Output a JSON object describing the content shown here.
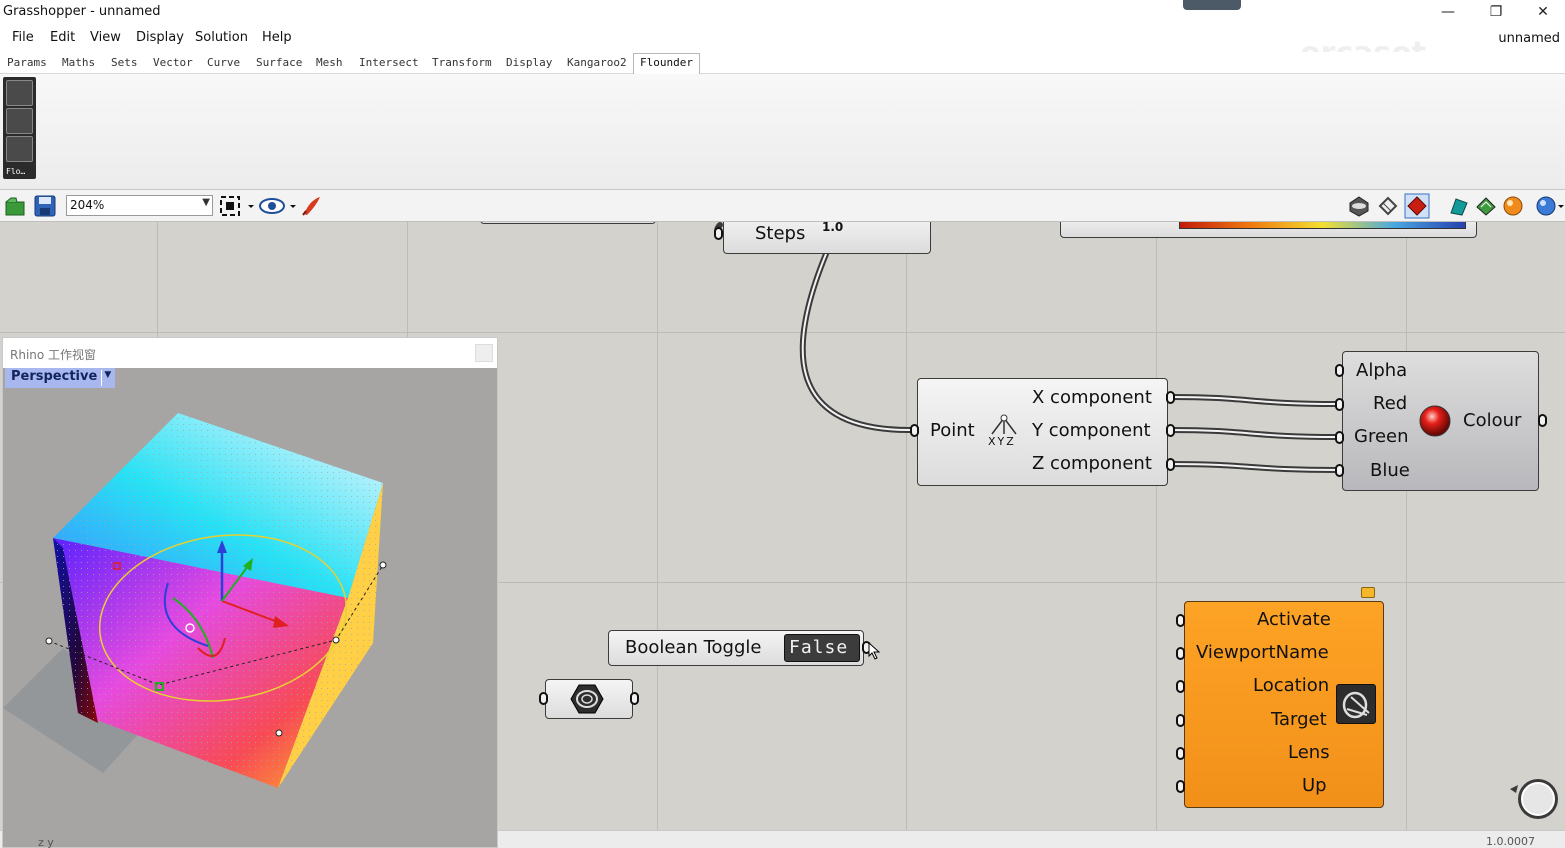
{
  "window": {
    "title": "Grasshopper - unnamed",
    "document_name": "unnamed"
  },
  "menu": [
    "File",
    "Edit",
    "View",
    "Display",
    "Solution",
    "Help"
  ],
  "tabs": [
    "Params",
    "Maths",
    "Sets",
    "Vector",
    "Curve",
    "Surface",
    "Mesh",
    "Intersect",
    "Transform",
    "Display",
    "Kangaroo2",
    "Flounder"
  ],
  "active_tab": "Flounder",
  "watermark": "orcasot",
  "ribbon": {
    "panel_label": "Flo…"
  },
  "toolbar": {
    "zoom": "204%"
  },
  "canvas": {
    "steps_component": {
      "label": "Steps",
      "value": "1.0"
    },
    "deconstruct_point": {
      "input": "Point",
      "icon_text": "XYZ",
      "outputs": [
        "X component",
        "Y component",
        "Z component"
      ]
    },
    "colour_rgba": {
      "inputs": [
        "Alpha",
        "Red",
        "Green",
        "Blue"
      ],
      "output": "Colour"
    },
    "boolean_toggle": {
      "label": "Boolean Toggle",
      "value": "False"
    },
    "flounder_camera": {
      "inputs": [
        "Activate",
        "ViewportName",
        "Location",
        "Target",
        "Lens",
        "Up"
      ]
    }
  },
  "rhino_viewport": {
    "title": "Rhino 工作视窗",
    "viewport_name": "Perspective",
    "axes_label": "z y"
  },
  "status": {
    "version": "1.0.0007"
  }
}
